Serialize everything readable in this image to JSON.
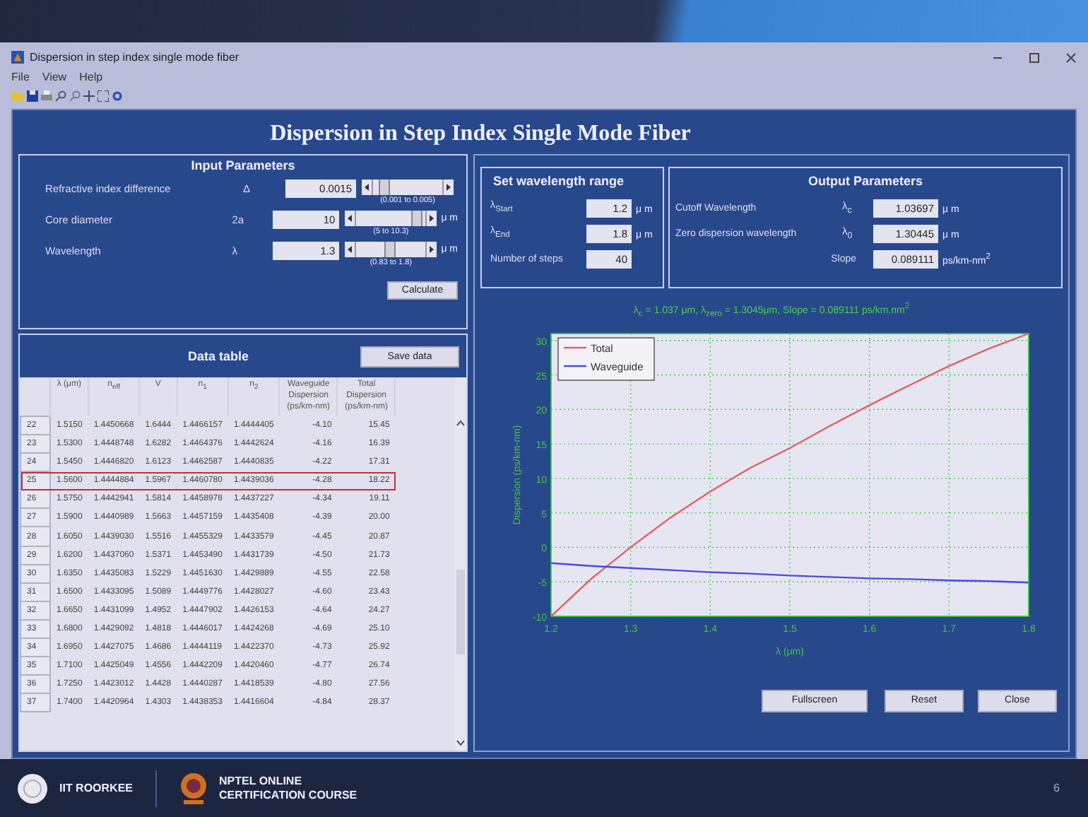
{
  "window": {
    "title": "Dispersion in step index single mode fiber"
  },
  "menu": [
    "File",
    "View",
    "Help"
  ],
  "header": "Dispersion in Step Index Single Mode Fiber",
  "input_parameters": {
    "title": "Input Parameters",
    "calculate": "Calculate",
    "rows": [
      {
        "label": "Refractive index difference",
        "symbol": "Δ",
        "value": "0.0015",
        "level": 0.1,
        "range": "(0.001 to 0.005)"
      },
      {
        "label": "Core diameter",
        "symbol": "2a",
        "value": "10",
        "level": 0.94,
        "range": "(5 to 10.3)",
        "unit": "μ m"
      },
      {
        "label": "Wavelength",
        "symbol": "λ",
        "value": "1.3",
        "level": 0.48,
        "range": "(0.83 to 1.8)",
        "unit": "μ m"
      }
    ]
  },
  "data_table": {
    "title": "Data table",
    "save": "Save data",
    "columns": [
      "λ (μm)",
      "n$_{eff}$",
      "V",
      "n$_{1}$",
      "n$_{2}$",
      "Waveguide Dispersion (ps/km-nm)",
      "Total Dispersion (ps/km-nm)"
    ],
    "rows": [
      {
        "index": "22",
        "cells": [
          "1.5150",
          "1.4450668",
          "1.6444",
          "1.4466157",
          "1.4444405",
          "-4.10",
          "15.45"
        ],
        "selected": false
      },
      {
        "index": "23",
        "cells": [
          "1.5300",
          "1.4448748",
          "1.6282",
          "1.4464376",
          "1.4442624",
          "-4.16",
          "16.39"
        ],
        "selected": false
      },
      {
        "index": "24",
        "cells": [
          "1.5450",
          "1.4446820",
          "1.6123",
          "1.4462587",
          "1.4440835",
          "-4.22",
          "17.31"
        ],
        "selected": false
      },
      {
        "index": "25",
        "cells": [
          "1.5600",
          "1.4444884",
          "1.5967",
          "1.4460780",
          "1.4439036",
          "-4.28",
          "18.22"
        ],
        "selected": true
      },
      {
        "index": "26",
        "cells": [
          "1.5750",
          "1.4442941",
          "1.5814",
          "1.4458978",
          "1.4437227",
          "-4.34",
          "19.11"
        ],
        "selected": false
      },
      {
        "index": "27",
        "cells": [
          "1.5900",
          "1.4440989",
          "1.5663",
          "1.4457159",
          "1.4435408",
          "-4.39",
          "20.00"
        ],
        "selected": false
      },
      {
        "index": "28",
        "cells": [
          "1.6050",
          "1.4439030",
          "1.5516",
          "1.4455329",
          "1.4433579",
          "-4.45",
          "20.87"
        ],
        "selected": false
      },
      {
        "index": "29",
        "cells": [
          "1.6200",
          "1.4437060",
          "1.5371",
          "1.4453490",
          "1.4431739",
          "-4.50",
          "21.73"
        ],
        "selected": false
      },
      {
        "index": "30",
        "cells": [
          "1.6350",
          "1.4435083",
          "1.5229",
          "1.4451630",
          "1.4429889",
          "-4.55",
          "22.58"
        ],
        "selected": false
      },
      {
        "index": "31",
        "cells": [
          "1.6500",
          "1.4433095",
          "1.5089",
          "1.4449776",
          "1.4428027",
          "-4.60",
          "23.43"
        ],
        "selected": false
      },
      {
        "index": "32",
        "cells": [
          "1.6650",
          "1.4431099",
          "1.4952",
          "1.4447902",
          "1.4426153",
          "-4.64",
          "24.27"
        ],
        "selected": false
      },
      {
        "index": "33",
        "cells": [
          "1.6800",
          "1.4429092",
          "1.4818",
          "1.4446017",
          "1.4424268",
          "-4.69",
          "25.10"
        ],
        "selected": false
      },
      {
        "index": "34",
        "cells": [
          "1.6950",
          "1.4427075",
          "1.4686",
          "1.4444119",
          "1.4422370",
          "-4.73",
          "25.92"
        ],
        "selected": false
      },
      {
        "index": "35",
        "cells": [
          "1.7100",
          "1.4425049",
          "1.4556",
          "1.4442209",
          "1.4420460",
          "-4.77",
          "26.74"
        ],
        "selected": false
      },
      {
        "index": "36",
        "cells": [
          "1.7250",
          "1.4423012",
          "1.4428",
          "1.4440287",
          "1.4418539",
          "-4.80",
          "27.56"
        ],
        "selected": false
      },
      {
        "index": "37",
        "cells": [
          "1.7400",
          "1.4420964",
          "1.4303",
          "1.4438353",
          "1.4416604",
          "-4.84",
          "28.37"
        ],
        "selected": false
      }
    ]
  },
  "wavelength_range": {
    "title": "Set wavelength range",
    "rows": [
      {
        "label": "λ$_{Start}$",
        "value": "1.2",
        "unit": "μ m"
      },
      {
        "label": "λ$_{End}$",
        "value": "1.8",
        "unit": "μ m"
      },
      {
        "label": "Number of steps",
        "value": "40"
      }
    ]
  },
  "output_parameters": {
    "title": "Output Parameters",
    "rows": [
      {
        "label": "Cutoff Wavelength",
        "symbol": "λ$_{c}$",
        "value": "1.03697",
        "unit": "μ m"
      },
      {
        "label": "Zero dispersion wavelength",
        "symbol": "λ$_{0}$",
        "value": "1.30445",
        "unit": "μ m"
      },
      {
        "label": "Slope",
        "value": "0.089111",
        "unit": "ps/km-nm$^{2}$"
      }
    ]
  },
  "plot": {
    "chart_data": {
      "type": "line",
      "title": "λ$_{c}$ = 1.037 μm, λ$_{zero}$ = 1.3045μm, Slope = 0.089111 ps/km.nm$^{2}$",
      "xlabel": "λ (μm)",
      "ylabel": "Dispersion (ps/km-nm)",
      "x": [
        1.2,
        1.25,
        1.3,
        1.35,
        1.4,
        1.45,
        1.5,
        1.55,
        1.6,
        1.65,
        1.7,
        1.75,
        1.8
      ],
      "series": [
        {
          "name": "Total",
          "color": "#e06060",
          "values": [
            -10,
            -4.6,
            0,
            4.3,
            8.1,
            11.5,
            14.4,
            17.6,
            20.6,
            23.5,
            26.3,
            28.8,
            31
          ]
        },
        {
          "name": "Waveguide",
          "color": "#4a4ae0",
          "values": [
            -2.3,
            -2.7,
            -3.0,
            -3.3,
            -3.6,
            -3.8,
            -4.1,
            -4.3,
            -4.5,
            -4.6,
            -4.8,
            -4.9,
            -5.1
          ]
        }
      ],
      "xlim": [
        1.2,
        1.8
      ],
      "ylim": [
        -10,
        31
      ],
      "grid": true,
      "legend": true,
      "xticks": [
        1.2,
        1.3,
        1.4,
        1.5,
        1.6,
        1.7,
        1.8
      ],
      "yticks": [
        -10,
        -5,
        0,
        5,
        10,
        15,
        20,
        25,
        30
      ]
    }
  },
  "buttons": [
    "Fullscreen",
    "Reset",
    "Close"
  ],
  "footer": {
    "institute": "IIT ROORKEE",
    "course": [
      "NPTEL ONLINE",
      "CERTIFICATION COURSE"
    ],
    "page": "6"
  }
}
